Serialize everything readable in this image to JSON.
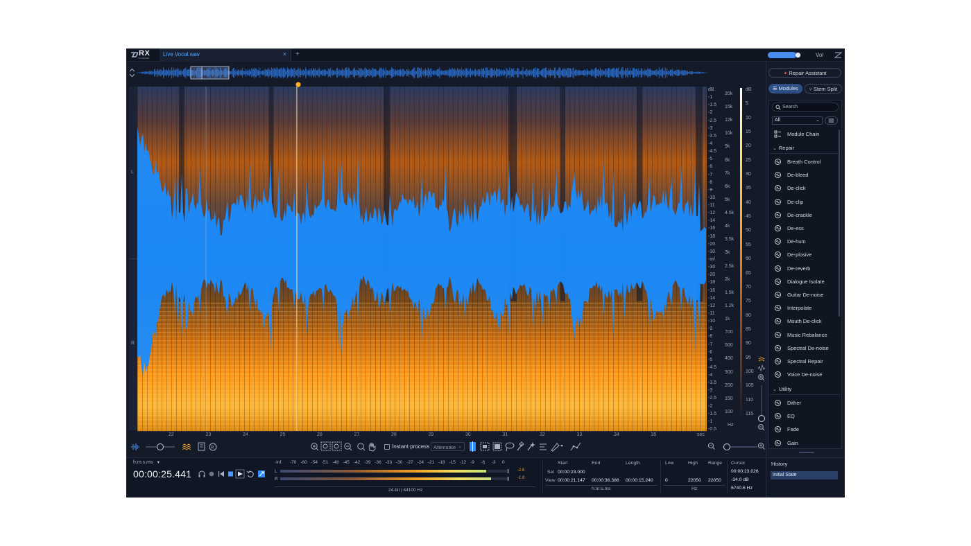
{
  "app": {
    "logo_text": "RX",
    "logo_sub": "STANDARD",
    "tab_name": "Live Vocal.wav",
    "tab_close": "×",
    "new_tab": "+",
    "vol_label": "Vol",
    "volume_level": 0.85
  },
  "left_ruler": {
    "top": "L",
    "bottom": "R"
  },
  "db_axis": [
    "dB",
    "-1",
    "-1.5",
    "-2",
    "-2.5",
    "-3",
    "-3.5",
    "-4",
    "-4.5",
    "-5",
    "-6",
    "-7",
    "-8",
    "-9",
    "-10",
    "-11",
    "-12",
    "-14",
    "-16",
    "-18",
    "-20",
    "-30",
    "-inf",
    "-30",
    "-20",
    "-18",
    "-16",
    "-14",
    "-12",
    "-11",
    "-10",
    "-9",
    "-8",
    "-7",
    "-6",
    "-5",
    "-4.5",
    "-4",
    "-3.5",
    "-3",
    "-2.5",
    "-2",
    "-1.5",
    "-1",
    "-0.5"
  ],
  "hz_axis": [
    "20k",
    "15k",
    "12k",
    "10k",
    "9k",
    "8k",
    "7k",
    "6k",
    "5k",
    "4.5k",
    "4k",
    "3.5k",
    "3k",
    "2.5k",
    "2k",
    "1.5k",
    "1.2k",
    "1k",
    "700",
    "500",
    "400",
    "300",
    "200",
    "150",
    "100",
    "Hz"
  ],
  "color_db_axis": [
    "dB",
    "5",
    "10",
    "15",
    "20",
    "25",
    "30",
    "35",
    "40",
    "45",
    "50",
    "55",
    "60",
    "65",
    "70",
    "75",
    "80",
    "85",
    "90",
    "95",
    "100",
    "105",
    "110",
    "115"
  ],
  "time_ruler": [
    "22",
    "23",
    "24",
    "25",
    "26",
    "27",
    "28",
    "29",
    "30",
    "31",
    "32",
    "33",
    "34",
    "35",
    "sec"
  ],
  "toolbar": {
    "instant_process": "Instant process",
    "attenuate": "Attenuate",
    "instant_checked": false
  },
  "transport": {
    "time_format": "h:m:s.ms",
    "time_format_chev": "▼",
    "timecode": "00:00:25.441"
  },
  "meters": {
    "scale": [
      "-Inf.",
      "-70",
      "-60",
      "-54",
      "-51",
      "-48",
      "-45",
      "-42",
      "-39",
      "-36",
      "-33",
      "-30",
      "-27",
      "-24",
      "-21",
      "-18",
      "-15",
      "-12",
      "-9",
      "-6",
      "-3",
      "0"
    ],
    "left_label": "L",
    "right_label": "R",
    "left_peak": "-2.6",
    "right_peak": "-1.9",
    "left_level": 0.9,
    "right_level": 0.92,
    "format": "24-bit | 44100 Hz"
  },
  "selection": {
    "start_label": "Start",
    "end_label": "End",
    "length_label": "Length",
    "sel_label": "Sel",
    "view_label": "View",
    "sel_start": "00:00:23.000",
    "view_start": "00:00:21.147",
    "view_end": "00:00:36.386",
    "view_length": "00:00:15.240",
    "units": "h:m:s.ms"
  },
  "freq": {
    "low_label": "Low",
    "high_label": "High",
    "range_label": "Range",
    "low": "0",
    "high": "22050",
    "range": "22050",
    "units": "Hz"
  },
  "cursor": {
    "label": "Cursor",
    "time": "00:00:23.026",
    "db": "-34.0 dB",
    "hz": "6740.6 Hz"
  },
  "right_panel": {
    "repair_assistant": "Repair Assistant",
    "modules_tab": "Modules",
    "stem_split_tab": "Stem Split",
    "search_placeholder": "Search",
    "filter_value": "All",
    "module_chain": "Module Chain",
    "repair_section": "Repair",
    "repair_items": [
      {
        "label": "Breath Control",
        "icon": "breath-icon"
      },
      {
        "label": "De-bleed",
        "icon": "debleed-icon"
      },
      {
        "label": "De-click",
        "icon": "declick-icon"
      },
      {
        "label": "De-clip",
        "icon": "declip-icon"
      },
      {
        "label": "De-crackle",
        "icon": "decrackle-icon"
      },
      {
        "label": "De-ess",
        "icon": "deess-icon"
      },
      {
        "label": "De-hum",
        "icon": "dehum-icon"
      },
      {
        "label": "De-plosive",
        "icon": "deplosive-icon"
      },
      {
        "label": "De-reverb",
        "icon": "dereverb-icon"
      },
      {
        "label": "Dialogue Isolate",
        "icon": "dialogue-isolate-icon"
      },
      {
        "label": "Guitar De-noise",
        "icon": "guitar-icon"
      },
      {
        "label": "Interpolate",
        "icon": "interpolate-icon"
      },
      {
        "label": "Mouth De-click",
        "icon": "mouth-icon"
      },
      {
        "label": "Music Rebalance",
        "icon": "music-rebalance-icon"
      },
      {
        "label": "Spectral De-noise",
        "icon": "spectral-denoise-icon"
      },
      {
        "label": "Spectral Repair",
        "icon": "spectral-repair-icon"
      },
      {
        "label": "Voice De-noise",
        "icon": "voice-denoise-icon"
      }
    ],
    "utility_section": "Utility",
    "utility_items": [
      {
        "label": "Dither",
        "icon": "dither-icon"
      },
      {
        "label": "EQ",
        "icon": "eq-icon"
      },
      {
        "label": "Fade",
        "icon": "fade-icon"
      },
      {
        "label": "Gain",
        "icon": "gain-icon"
      }
    ],
    "history_title": "History",
    "history_item": "Initial State"
  },
  "colors": {
    "accent": "#2f8cff",
    "waveform": "#1a8cff",
    "spectro_hot": "#ffb020",
    "background": "#141a28"
  }
}
